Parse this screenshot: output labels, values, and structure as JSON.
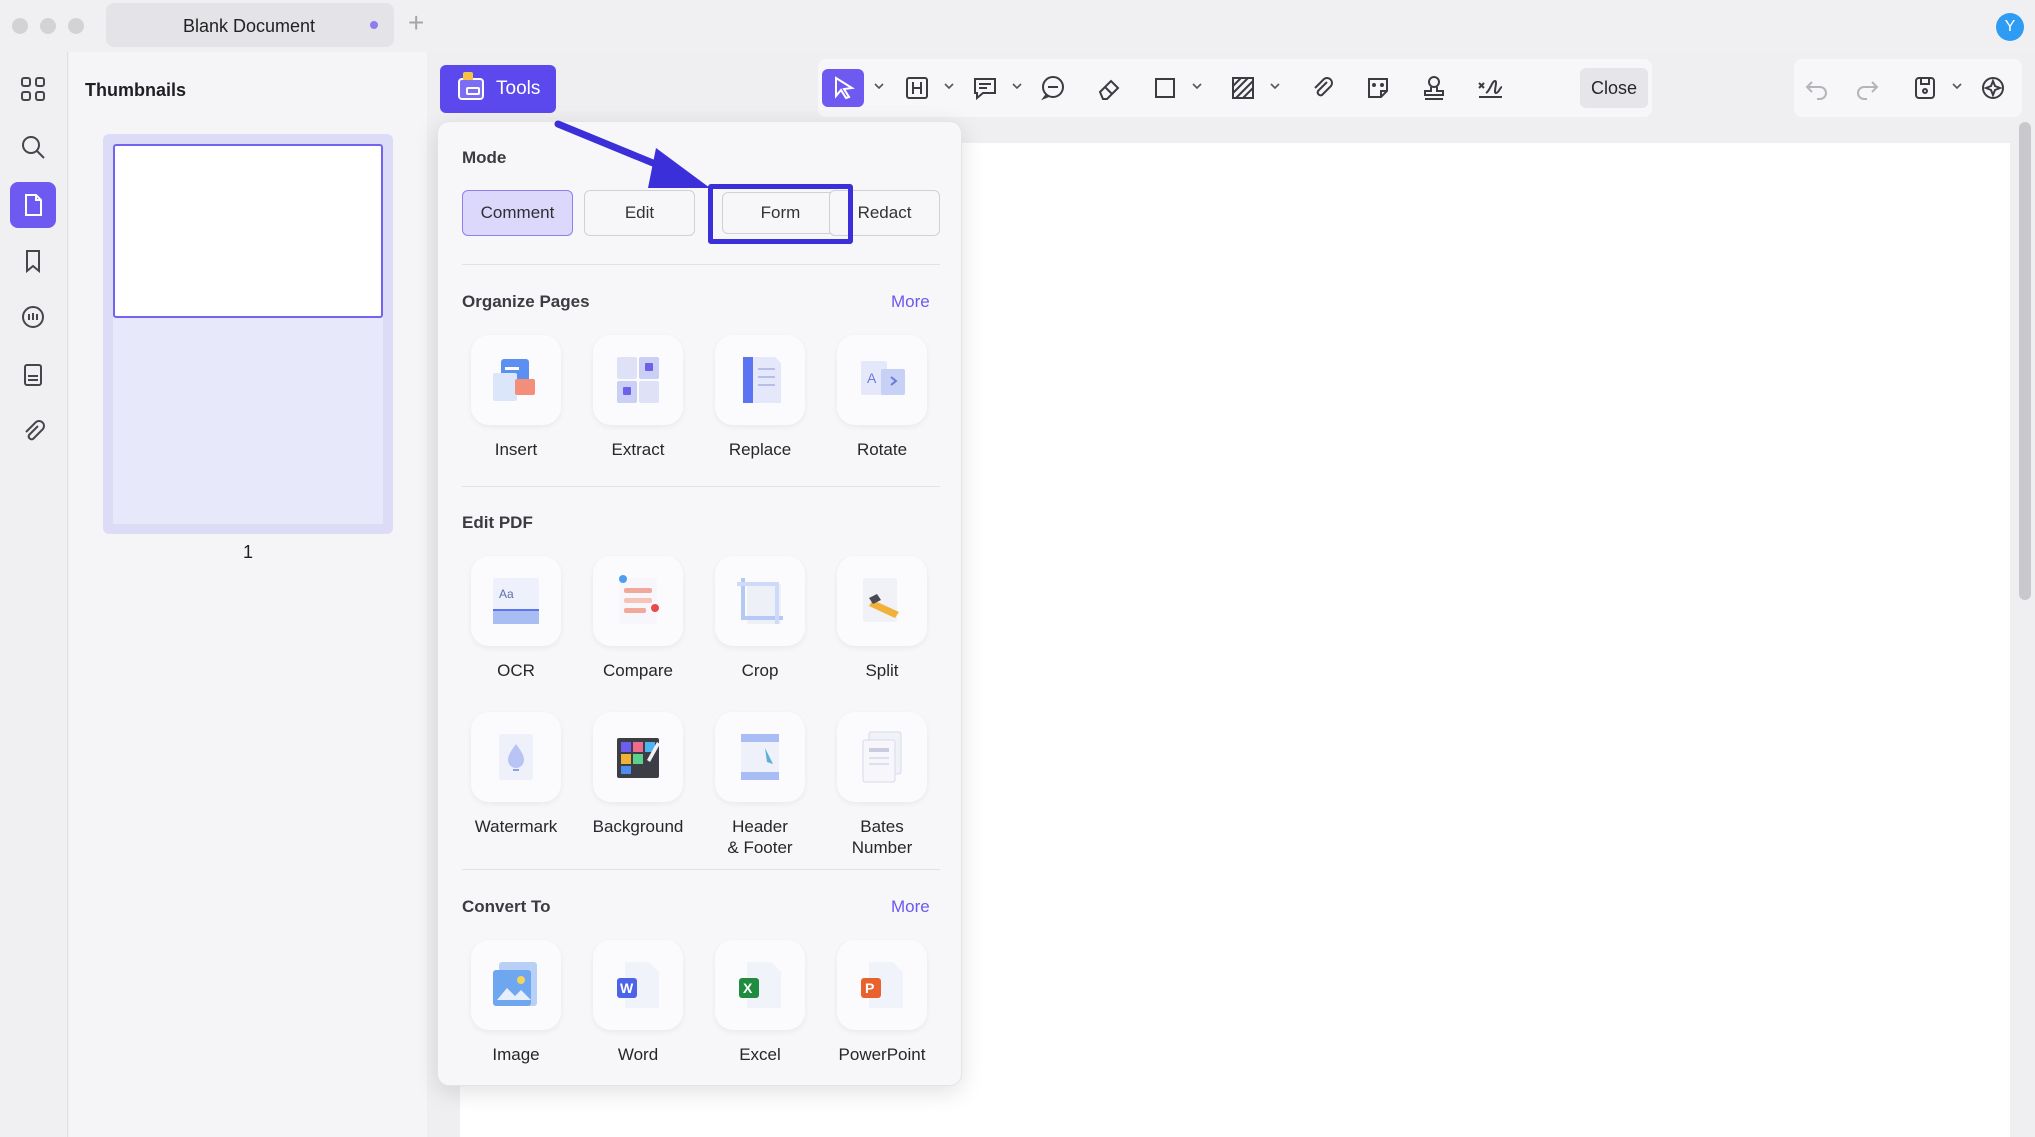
{
  "window": {
    "tab_title": "Blank Document",
    "tab_new_symbol": "+",
    "avatar_letter": "Y"
  },
  "sidebar": {
    "items": [
      {
        "name": "grid-icon"
      },
      {
        "name": "search-icon"
      },
      {
        "name": "pages-icon",
        "active": true
      },
      {
        "name": "bookmark-icon"
      },
      {
        "name": "comment-list-icon"
      },
      {
        "name": "form-fields-icon"
      },
      {
        "name": "attachment-icon"
      }
    ]
  },
  "thumbnails": {
    "title": "Thumbnails",
    "pages": [
      {
        "number": "1"
      }
    ]
  },
  "toolbar": {
    "tools_label": "Tools",
    "close_label": "Close"
  },
  "tools_panel": {
    "mode": {
      "title": "Mode",
      "options": [
        "Comment",
        "Edit",
        "Form",
        "Redact"
      ],
      "selected": "Comment",
      "highlighted": "Form"
    },
    "organize": {
      "title": "Organize Pages",
      "more": "More",
      "items": [
        "Insert",
        "Extract",
        "Replace",
        "Rotate"
      ]
    },
    "edit_pdf": {
      "title": "Edit PDF",
      "items": [
        "OCR",
        "Compare",
        "Crop",
        "Split",
        "Watermark",
        "Background"
      ],
      "header_footer": [
        "Header",
        "& Footer"
      ],
      "bates": [
        "Bates",
        "Number"
      ]
    },
    "convert": {
      "title": "Convert To",
      "more": "More",
      "items": [
        "Image",
        "Word",
        "Excel",
        "PowerPoint"
      ]
    }
  },
  "colors": {
    "accent": "#6e5af0",
    "annotation": "#3a2fd8"
  }
}
